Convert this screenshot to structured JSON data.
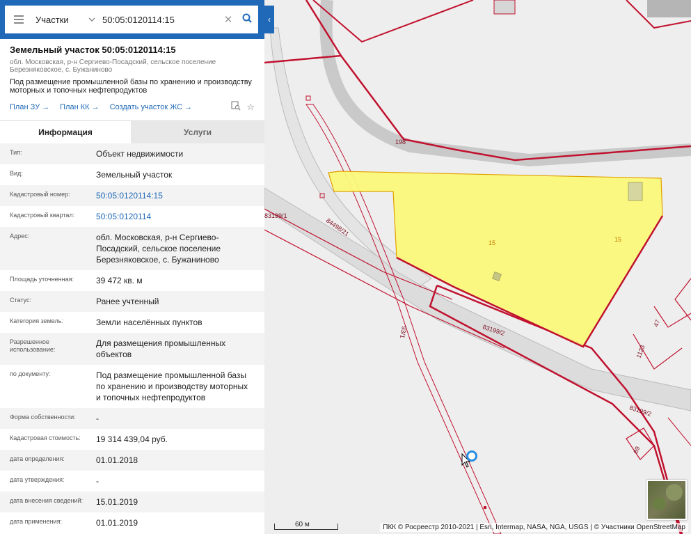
{
  "search": {
    "layer": "Участки",
    "query": "50:05:0120114:15"
  },
  "parcel": {
    "title": "Земельный участок 50:05:0120114:15",
    "address_short": "обл. Московская, р-н Сергиево-Посадский, сельское поселение Березняковское, с. Бужаниново",
    "purpose": "Под размещение промышленной базы по хранению и производству моторных и топочных нефтепродуктов",
    "links": [
      "План ЗУ →",
      "План КК →",
      "Создать участок ЖС →"
    ]
  },
  "tabs": [
    "Информация",
    "Услуги"
  ],
  "rows": [
    {
      "label": "Тип:",
      "value": "Объект недвижимости",
      "link": false
    },
    {
      "label": "Вид:",
      "value": "Земельный участок",
      "link": false
    },
    {
      "label": "Кадастровый номер:",
      "value": "50:05:0120114:15",
      "link": true
    },
    {
      "label": "Кадастровый квартал:",
      "value": "50:05:0120114",
      "link": true
    },
    {
      "label": "Адрес:",
      "value": "обл. Московская, р-н Сергиево-Посадский, сельское поселение Березняковское, с. Бужаниново",
      "link": false
    },
    {
      "label": "Площадь уточненная:",
      "value": "39 472 кв. м",
      "link": false
    },
    {
      "label": "Статус:",
      "value": "Ранее учтенный",
      "link": false
    },
    {
      "label": "Категория земель:",
      "value": "Земли населённых пунктов",
      "link": false
    },
    {
      "label": "Разрешенное использование:",
      "value": "Для размещения промышленных объектов",
      "link": false
    },
    {
      "label": "по документу:",
      "value": "Под размещение промышленной базы по хранению и производству моторных и топочных нефтепродуктов",
      "link": false
    },
    {
      "label": "Форма собственности:",
      "value": "-",
      "link": false
    },
    {
      "label": "Кадастровая стоимость:",
      "value": "19 314 439,04 руб.",
      "link": false
    },
    {
      "label": "дата определения:",
      "value": "01.01.2018",
      "link": false
    },
    {
      "label": "дата утверждения:",
      "value": "-",
      "link": false
    },
    {
      "label": "дата внесения сведений:",
      "value": "15.01.2019",
      "link": false
    },
    {
      "label": "дата применения:",
      "value": "01.01.2019",
      "link": false
    }
  ],
  "map": {
    "labels": [
      "198",
      "15",
      "15",
      "84498/21",
      "83199/1",
      "83199/2",
      "83199/2",
      "93/1",
      "47",
      "1123",
      "89"
    ],
    "scale": "60 м",
    "attribution": "ПКК © Росреестр 2010-2021 | Esri, Intermap, NASA, NGA, USGS | © Участники OpenStreetMap",
    "parcel_color": "#fbf87a",
    "boundary_color": "#c0122f"
  }
}
